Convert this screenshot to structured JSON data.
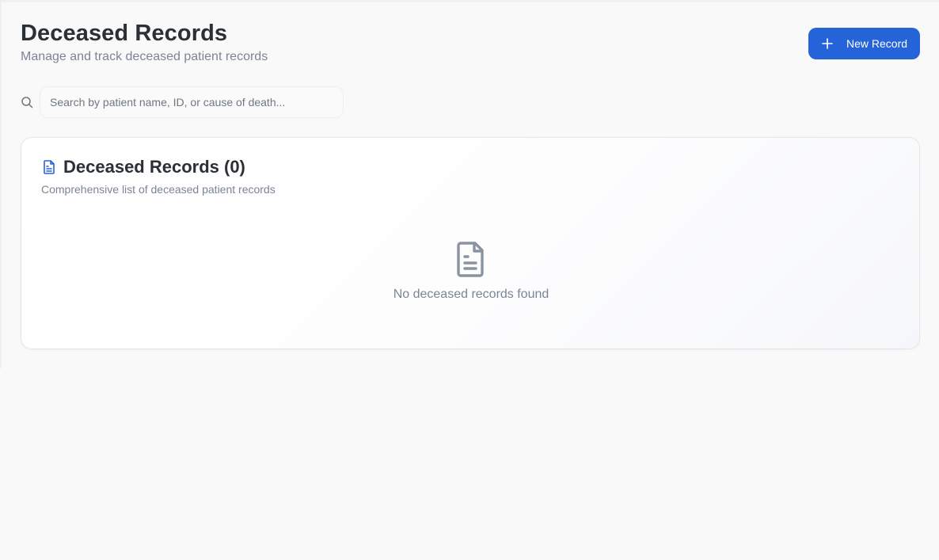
{
  "header": {
    "title": "Deceased Records",
    "subtitle": "Manage and track deceased patient records",
    "new_record_label": "New Record",
    "new_record_icon": "plus-icon"
  },
  "search": {
    "icon": "search-icon",
    "value": "",
    "placeholder": "Search by patient name, ID, or cause of death..."
  },
  "records_card": {
    "icon": "file-text-icon",
    "title": "Deceased Records (0)",
    "count": 0,
    "subtitle": "Comprehensive list of deceased patient records",
    "empty_icon": "file-text-icon",
    "empty_message": "No deceased records found"
  },
  "colors": {
    "accent": "#2563d9",
    "background": "#f9f9f9",
    "text_primary": "#2b2f36",
    "text_muted": "#7b8596",
    "icon_muted": "#8a93a2"
  }
}
